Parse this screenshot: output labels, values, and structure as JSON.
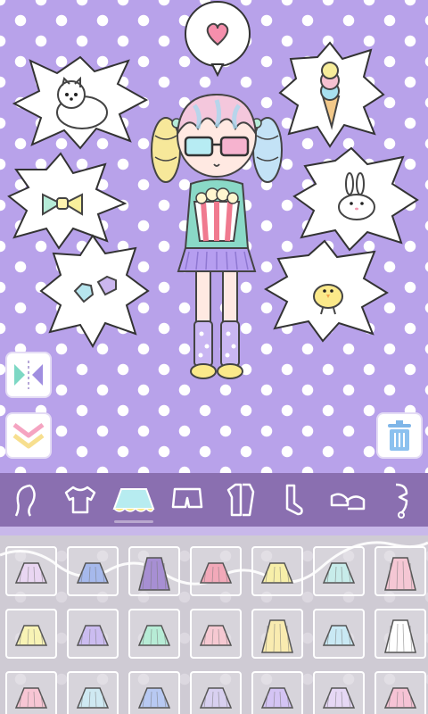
{
  "game": {
    "screen": "Dress-up closet",
    "active_category": "skirts"
  },
  "bubbles": [
    {
      "name": "heart-bubble",
      "icon": "heart"
    },
    {
      "name": "dog-bubble",
      "icon": "pomeranian-dog"
    },
    {
      "name": "icecream-bubble",
      "icon": "ice-cream-cone"
    },
    {
      "name": "bow-bubble",
      "icon": "bow-tie"
    },
    {
      "name": "bunny-bubble",
      "icon": "white-bunny"
    },
    {
      "name": "gems-bubble",
      "icon": "pastel-gems"
    },
    {
      "name": "chick-bubble",
      "icon": "baby-chick"
    }
  ],
  "side_buttons": [
    {
      "name": "flip-button",
      "icon": "flip-mirror"
    },
    {
      "name": "collapse-button",
      "icon": "double-chevron-down"
    },
    {
      "name": "trash-button",
      "icon": "trash-can"
    }
  ],
  "categories": [
    {
      "name": "hair",
      "icon": "hair-icon"
    },
    {
      "name": "tops",
      "icon": "tshirt-icon"
    },
    {
      "name": "skirts",
      "icon": "skirt-icon",
      "active": true
    },
    {
      "name": "pants",
      "icon": "shorts-icon"
    },
    {
      "name": "outfits",
      "icon": "outfit-icon"
    },
    {
      "name": "socks",
      "icon": "socks-icon"
    },
    {
      "name": "shoes",
      "icon": "shoes-icon"
    },
    {
      "name": "accessories",
      "icon": "accessory-icon"
    }
  ],
  "skirt_colors": {
    "row1": [
      "#e9d6f2",
      "#a6b9ec",
      "#a78fd3",
      "#f2a9b9",
      "#f7efa9",
      "#c7ecea",
      "#f5c7d4"
    ],
    "row2": [
      "#f8f3b5",
      "#cbbcf0",
      "#b7ecd6",
      "#f6c9d2",
      "#f9ebb0",
      "#c9e9f4",
      "#ffffff"
    ],
    "row3": [
      "#f7c6d4",
      "#cfe9f2",
      "#b8c9f2",
      "#d8d0f0",
      "#d4c4f4",
      "#e6d8f5",
      "#f6c3d5"
    ]
  },
  "colors": {
    "stage_purple": "#b8a2ea",
    "category_bar": "#8a6fb0",
    "panel_gray": "#cfcbd4"
  }
}
